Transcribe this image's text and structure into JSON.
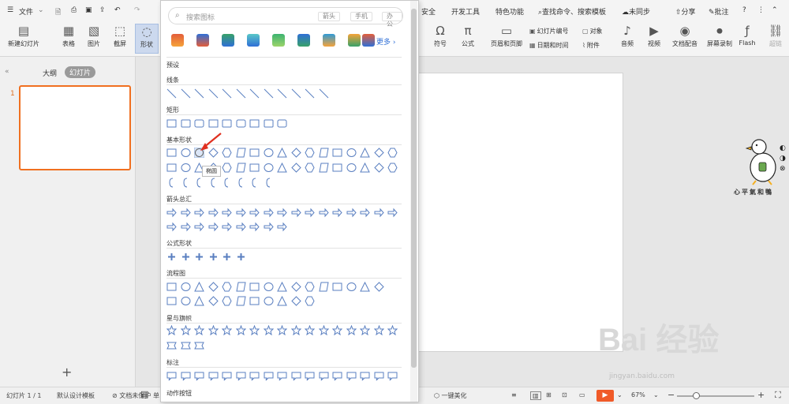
{
  "menubar": {
    "menu_label": "文件",
    "tabs_right": [
      "安全",
      "开发工具",
      "特色功能"
    ],
    "search": "查找命令、搜索模板",
    "sync": "未同步",
    "share": "分享",
    "annotate": "批注",
    "help": "?"
  },
  "ribbon": {
    "new_slide": "新建幻灯片",
    "table": "表格",
    "picture": "图片",
    "screenshot": "截屏",
    "shape": "形状",
    "symbol": "符号",
    "formula": "公式",
    "header_footer": "页眉和页脚",
    "slide_number": "幻灯片编号",
    "object": "对象",
    "datetime": "日期和时间",
    "attachment": "附件",
    "audio": "音频",
    "video": "视频",
    "narration": "文档配音",
    "screen_record": "屏幕录制",
    "flash": "Flash",
    "hyperlink": "超链"
  },
  "left_panel": {
    "tab_outline": "大纲",
    "tab_slides": "幻灯片",
    "slide_index": "1",
    "add": "+"
  },
  "shapes_panel": {
    "search_placeholder": "搜索图标",
    "chips": [
      "箭头",
      "手机",
      "办公"
    ],
    "more": "更多",
    "preset": "预设",
    "sections": [
      "线条",
      "矩形",
      "基本形状",
      "箭头总汇",
      "公式形状",
      "流程图",
      "星与旗帜",
      "标注",
      "动作按钮"
    ],
    "tooltip": "椭圆",
    "partial_tab": "单"
  },
  "status": {
    "slide": "幻灯片 1 / 1",
    "template": "默认设计模板",
    "unprotected": "文档未保护",
    "beautify": "一键美化",
    "zoom": "67%",
    "minus": "−",
    "plus": "+"
  },
  "decoration": {
    "duck_text": "心平氣和鴨",
    "watermark": "Bai 经验",
    "watermark_url": "jingyan.baidu.com"
  },
  "colors": {
    "accent": "#f07020",
    "shape_stroke": "#5a7fc0",
    "panel_bg": "#ffffff"
  }
}
